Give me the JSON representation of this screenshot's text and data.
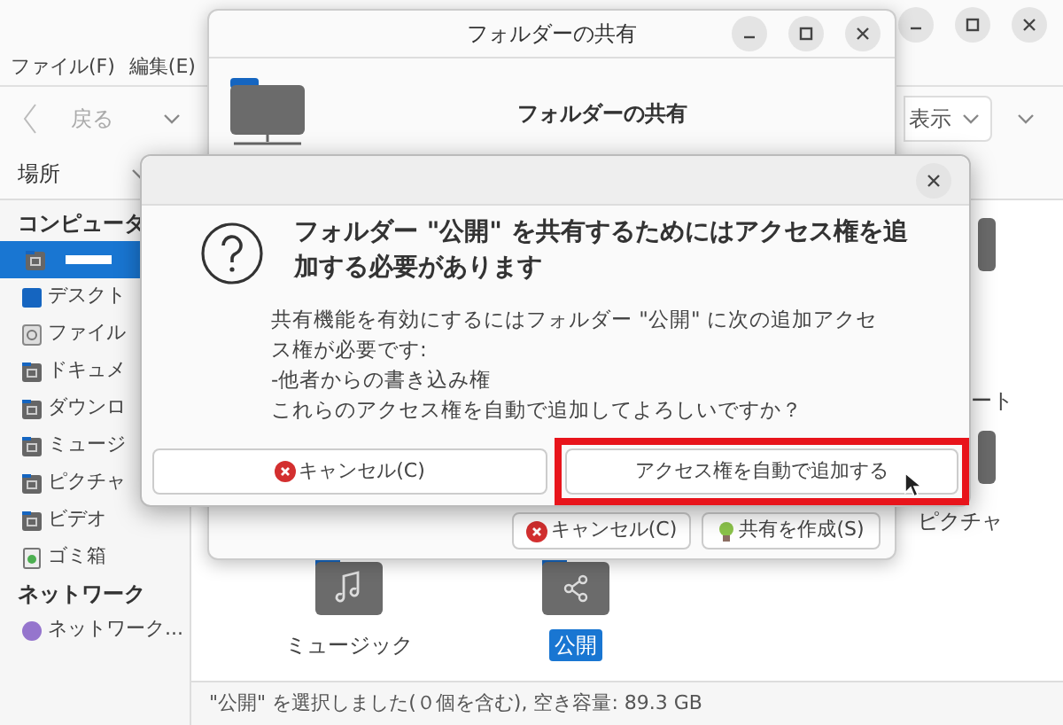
{
  "file_manager": {
    "menu": [
      "ファイル(F)",
      "編集(E)"
    ],
    "toolbar": {
      "back": "戻る",
      "view": "表示"
    },
    "places_label": "場所",
    "sidebar": [
      {
        "kind": "header",
        "label": "コンピュータ"
      },
      {
        "kind": "redacted",
        "selected": true
      },
      {
        "kind": "item",
        "label": "デスクト",
        "selected": false
      },
      {
        "kind": "item",
        "label": "ファイル",
        "selected": false
      },
      {
        "kind": "item",
        "label": "ドキュメ",
        "selected": false
      },
      {
        "kind": "item",
        "label": "ダウンロ",
        "selected": false
      },
      {
        "kind": "item",
        "label": "ミュージ",
        "selected": false
      },
      {
        "kind": "item",
        "label": "ピクチャ",
        "selected": false
      },
      {
        "kind": "item",
        "label": "ビデオ",
        "selected": false
      },
      {
        "kind": "item",
        "label": "ゴミ箱",
        "selected": false
      },
      {
        "kind": "header",
        "label": "ネットワーク"
      },
      {
        "kind": "item",
        "label": "ネットワーク...",
        "selected": false
      }
    ],
    "files": [
      {
        "label": "ミュージック",
        "selected": false
      },
      {
        "label": "公開",
        "selected": true
      }
    ],
    "right_labels": [
      "ート",
      "ピクチャ"
    ],
    "status_bar": "\"公開\" を選択しました(０個を含む), 空き容量: 89.3 GB"
  },
  "share_window": {
    "title": "フォルダーの共有",
    "heading": "フォルダーの共有",
    "buttons": [
      "キャンセル(C)",
      "共有を作成(S)"
    ]
  },
  "alert": {
    "title": "フォルダー \"公開\" を共有するためにはアクセス権を追加する必要があります",
    "body": [
      "共有機能を有効にするにはフォルダー \"公開\" に次の追加アクセス権が必要です:",
      "-他者からの書き込み権",
      "これらのアクセス権を自動で追加してよろしいですか？"
    ],
    "buttons": [
      {
        "label": "キャンセル(C)",
        "highlighted": false
      },
      {
        "label": "アクセス権を自動で追加する",
        "highlighted": true
      }
    ]
  }
}
